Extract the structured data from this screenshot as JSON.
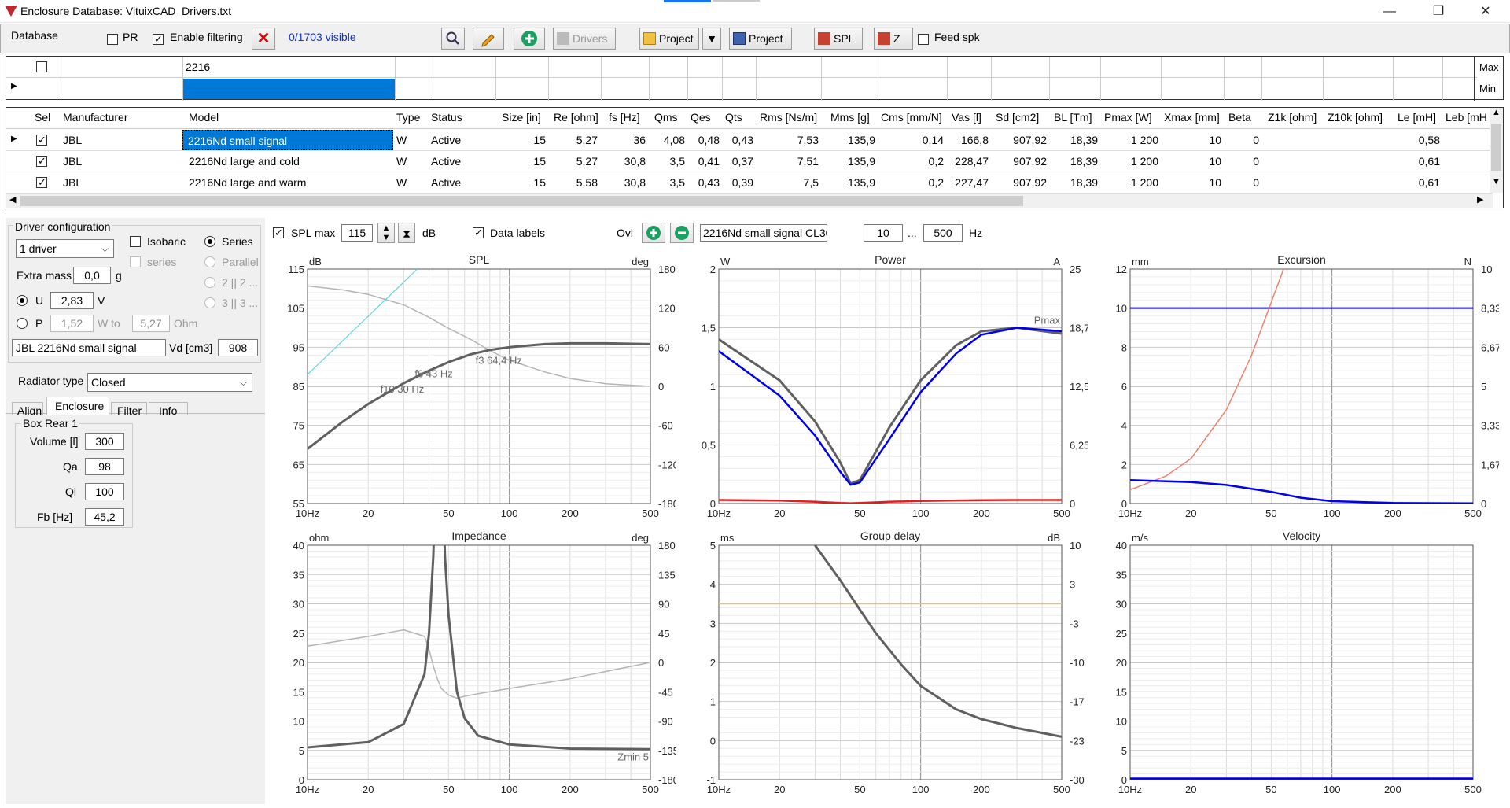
{
  "window": {
    "title": "Enclosure  Database: VituixCAD_Drivers.txt",
    "minimize": "—",
    "restore": "❐",
    "close": "✕"
  },
  "toolbar": {
    "database_label": "Database",
    "pr_label": "PR",
    "enable_filtering_label": "Enable filtering",
    "visible_count": "0/1703 visible",
    "drivers_label": "Drivers",
    "project_load_label": "Project",
    "project_save_label": "Project",
    "spl_label": "SPL",
    "z_label": "Z",
    "feed_spk_label": "Feed spk"
  },
  "filter": {
    "model_filter": "2216",
    "max_label": "Max",
    "min_label": "Min"
  },
  "table": {
    "columns": [
      "Sel",
      "Manufacturer",
      "Model",
      "Type",
      "Status",
      "Size [in]",
      "Re [ohm]",
      "fs [Hz]",
      "Qms",
      "Qes",
      "Qts",
      "Rms [Ns/m]",
      "Mms [g]",
      "Cms [mm/N]",
      "Vas [l]",
      "Sd [cm2]",
      "BL [Tm]",
      "Pmax [W]",
      "Xmax [mm]",
      "Beta",
      "Z1k [ohm]",
      "Z10k [ohm]",
      "Le [mH]",
      "Leb [mH"
    ],
    "rows": [
      {
        "manufacturer": "JBL",
        "model": "2216Nd small signal",
        "type": "W",
        "status": "Active",
        "size": "15",
        "re": "5,27",
        "fs": "36",
        "qms": "4,08",
        "qes": "0,48",
        "qts": "0,43",
        "rms": "7,53",
        "mms": "135,9",
        "cms": "0,14",
        "vas": "166,8",
        "sd": "907,92",
        "bl": "18,39",
        "pmax": "1 200",
        "xmax": "10",
        "beta": "0",
        "le": "0,58"
      },
      {
        "manufacturer": "JBL",
        "model": "2216Nd large and cold",
        "type": "W",
        "status": "Active",
        "size": "15",
        "re": "5,27",
        "fs": "30,8",
        "qms": "3,5",
        "qes": "0,41",
        "qts": "0,37",
        "rms": "7,51",
        "mms": "135,9",
        "cms": "0,2",
        "vas": "228,47",
        "sd": "907,92",
        "bl": "18,39",
        "pmax": "1 200",
        "xmax": "10",
        "beta": "0",
        "le": "0,61"
      },
      {
        "manufacturer": "JBL",
        "model": "2216Nd large and warm",
        "type": "W",
        "status": "Active",
        "size": "15",
        "re": "5,58",
        "fs": "30,8",
        "qms": "3,5",
        "qes": "0,43",
        "qts": "0,39",
        "rms": "7,5",
        "mms": "135,9",
        "cms": "0,2",
        "vas": "227,47",
        "sd": "907,92",
        "bl": "18,39",
        "pmax": "1 200",
        "xmax": "10",
        "beta": "0",
        "le": "0,61"
      }
    ]
  },
  "driver_config": {
    "group_label": "Driver configuration",
    "count_select": "1 driver",
    "isobaric_label": "Isobaric",
    "series_label": "Series",
    "series_sub_label": "series",
    "parallel_label": "Parallel",
    "opt_2x2": "2 || 2 ...",
    "opt_3x3": "3 || 3 ...",
    "extra_mass_label": "Extra mass",
    "extra_mass_value": "0,0",
    "extra_mass_unit": "g",
    "u_label": "U",
    "u_value": "2,83",
    "u_unit": "V",
    "p_label": "P",
    "p_value": "1,52",
    "w_to_label": "W to",
    "ohm_value": "5,27",
    "ohm_unit": "Ohm",
    "driver_name": "JBL 2216Nd small signal",
    "vd_label": "Vd [cm3]",
    "vd_value": "908",
    "radiator_label": "Radiator type",
    "radiator_value": "Closed"
  },
  "tabs": [
    "Align",
    "Enclosure",
    "Filter",
    "Info"
  ],
  "box": {
    "group_label": "Box Rear 1",
    "volume_label": "Volume [l]",
    "volume_value": "300",
    "qa_label": "Qa",
    "qa_value": "98",
    "ql_label": "Ql",
    "ql_value": "100",
    "fb_label": "Fb [Hz]",
    "fb_value": "45,2"
  },
  "graph_controls": {
    "spl_max_label": "SPL max",
    "spl_max_value": "115",
    "db_label": "dB",
    "data_labels_label": "Data labels",
    "ovl_label": "Ovl",
    "overlay_name": "2216Nd small signal CL300",
    "freq_from": "10",
    "ellipsis": "...",
    "freq_to": "500",
    "hz_label": "Hz"
  },
  "x_ticks": [
    "10Hz",
    "20",
    "50",
    "100",
    "200",
    "500"
  ],
  "colors": {
    "accent_selection": "#0078d7",
    "main_curve": "#606060",
    "phase_curve": "#b5b5b5",
    "blue_curve": "#0000ee",
    "red_curve": "#e02020",
    "cyan_curve": "#60d8e0",
    "salmon_curve": "#f08070",
    "orange_line": "#f0c070"
  },
  "chart_data": [
    {
      "type": "line",
      "title": "SPL",
      "ylabel": "dB",
      "y2label": "deg",
      "x": [
        10,
        15,
        20,
        30,
        40,
        50,
        64.4,
        80,
        100,
        150,
        200,
        300,
        500
      ],
      "ylim": [
        55,
        115
      ],
      "y2lim": [
        -180,
        180
      ],
      "yticks": [
        "115",
        "105",
        "95",
        "85",
        "75",
        "65",
        "55"
      ],
      "y2ticks": [
        "180",
        "120",
        "60",
        "0",
        "-60",
        "-120",
        "-180"
      ],
      "series": [
        {
          "values": [
            69,
            76,
            80.5,
            85.8,
            89,
            91.2,
            93.2,
            94.3,
            95,
            95.8,
            96,
            96,
            95.8
          ]
        },
        {
          "values": [
            154,
            148,
            141,
            125,
            106,
            89,
            72,
            55,
            40,
            22,
            12,
            4,
            0
          ]
        }
      ],
      "cyan_line": {
        "x": [
          10,
          35
        ],
        "y": [
          88,
          115
        ]
      },
      "annotations": [
        "f3 64,4 Hz",
        "f6 43 Hz",
        "f10 30 Hz"
      ]
    },
    {
      "type": "line",
      "title": "Power",
      "ylabel": "W",
      "y2label": "A",
      "x": [
        10,
        20,
        30,
        40,
        45,
        50,
        70,
        100,
        150,
        200,
        300,
        500
      ],
      "ylim": [
        0,
        2
      ],
      "y2lim": [
        0,
        25
      ],
      "yticks": [
        "2",
        "1,5",
        "1",
        "0,5",
        "0"
      ],
      "y2ticks": [
        "25",
        "18,7",
        "12,5",
        "6,25",
        "0"
      ],
      "series": [
        {
          "values": [
            1.4,
            1.05,
            0.7,
            0.35,
            0.17,
            0.2,
            0.65,
            1.05,
            1.35,
            1.47,
            1.5,
            1.45
          ]
        },
        {
          "values": [
            1.3,
            0.92,
            0.58,
            0.27,
            0.16,
            0.18,
            0.55,
            0.95,
            1.28,
            1.44,
            1.5,
            1.47
          ]
        },
        {
          "values": [
            0.03,
            0.025,
            0.015,
            0.005,
            0.003,
            0.005,
            0.015,
            0.022,
            0.026,
            0.028,
            0.03,
            0.03
          ]
        }
      ],
      "annotations": [
        "Pmax"
      ]
    },
    {
      "type": "line",
      "title": "Excursion",
      "ylabel": "mm",
      "y2label": "N",
      "x": [
        10,
        15,
        20,
        30,
        40,
        50,
        60
      ],
      "ylim": [
        0,
        12
      ],
      "y2lim": [
        0,
        10
      ],
      "yticks": [
        "12",
        "10",
        "8",
        "6",
        "4",
        "2",
        "0"
      ],
      "y2ticks": [
        "10",
        "8,33",
        "6,67",
        "5",
        "3,33",
        "1,67",
        "0"
      ],
      "xmax_line": 10,
      "series": [
        {
          "x": [
            10,
            15,
            20,
            30,
            40,
            50,
            60
          ],
          "values": [
            0.7,
            1.4,
            2.3,
            4.8,
            7.6,
            10.3,
            12.5
          ]
        },
        {
          "x": [
            10,
            20,
            30,
            50,
            70,
            100,
            200,
            500
          ],
          "values": [
            1.2,
            1.1,
            0.95,
            0.6,
            0.3,
            0.12,
            0.03,
            0.01
          ]
        }
      ]
    },
    {
      "type": "line",
      "title": "Impedance",
      "ylabel": "ohm",
      "y2label": "deg",
      "x": [
        10,
        20,
        30,
        38,
        40,
        42,
        44,
        46,
        48,
        50,
        55,
        60,
        70,
        100,
        200,
        500
      ],
      "ylim": [
        0,
        40
      ],
      "y2lim": [
        -180,
        180
      ],
      "yticks": [
        "40",
        "35",
        "30",
        "25",
        "20",
        "15",
        "10",
        "5",
        "0"
      ],
      "y2ticks": [
        "180",
        "135",
        "90",
        "45",
        "0",
        "-45",
        "-90",
        "-135",
        "-180"
      ],
      "series": [
        {
          "values": [
            5.5,
            6.4,
            9.5,
            18,
            25,
            38,
            60,
            60,
            38,
            28,
            15,
            10.5,
            7.5,
            6,
            5.3,
            5.2
          ]
        },
        {
          "values": [
            25,
            40,
            50,
            40,
            20,
            -5,
            -25,
            -40,
            -45,
            -50,
            -55,
            -52,
            -48,
            -40,
            -25,
            0
          ]
        }
      ],
      "annotations": [
        "Zmin 5"
      ]
    },
    {
      "type": "line",
      "title": "Group delay",
      "ylabel": "ms",
      "y2label": "dB",
      "x": [
        30,
        40,
        50,
        60,
        80,
        100,
        150,
        200,
        300,
        500
      ],
      "ylim": [
        -1,
        5
      ],
      "y2lim": [
        -30,
        10
      ],
      "yticks": [
        "5",
        "4",
        "3",
        "2",
        "1",
        "0",
        "-1"
      ],
      "y2ticks": [
        "10",
        "3",
        "-3",
        "-10",
        "-17",
        "-23",
        "-30"
      ],
      "series": [
        {
          "values": [
            5,
            4.1,
            3.35,
            2.75,
            1.95,
            1.4,
            0.8,
            0.55,
            0.32,
            0.1
          ]
        }
      ],
      "reference_y": 3.5
    },
    {
      "type": "line",
      "title": "Velocity",
      "ylabel": "m/s",
      "x": [
        10,
        500
      ],
      "ylim": [
        0,
        40
      ],
      "yticks": [
        "40",
        "35",
        "30",
        "25",
        "20",
        "15",
        "10",
        "5",
        "0"
      ],
      "series": [
        {
          "values": [
            0.2,
            0.2
          ]
        }
      ]
    }
  ]
}
